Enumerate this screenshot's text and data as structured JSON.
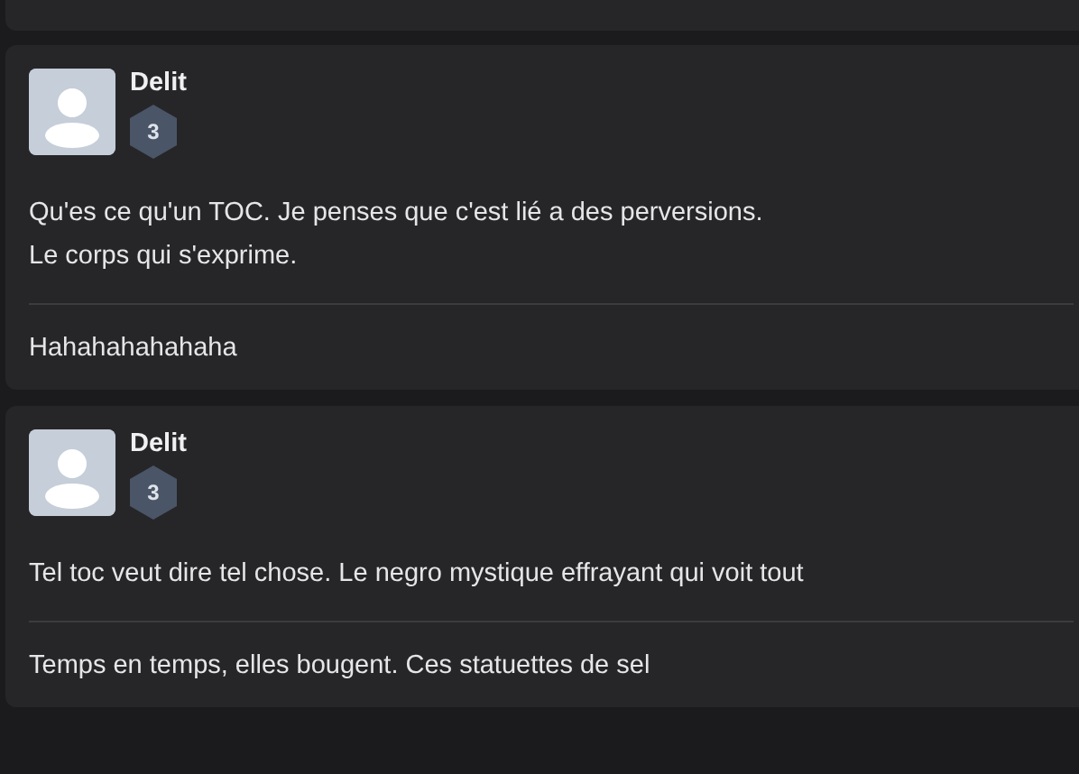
{
  "posts": [
    {
      "author": "Delit",
      "rank": "3",
      "body_lines": [
        "Qu'es ce qu'un TOC. Je penses que c'est lié a des perversions.",
        "Le corps qui s'exprime."
      ],
      "signature": "Hahahahahahaha"
    },
    {
      "author": "Delit",
      "rank": "3",
      "body_lines": [
        "Tel toc veut dire tel chose. Le negro mystique effrayant qui voit tout"
      ],
      "signature": "Temps en temps, elles bougent. Ces statuettes de sel"
    }
  ]
}
